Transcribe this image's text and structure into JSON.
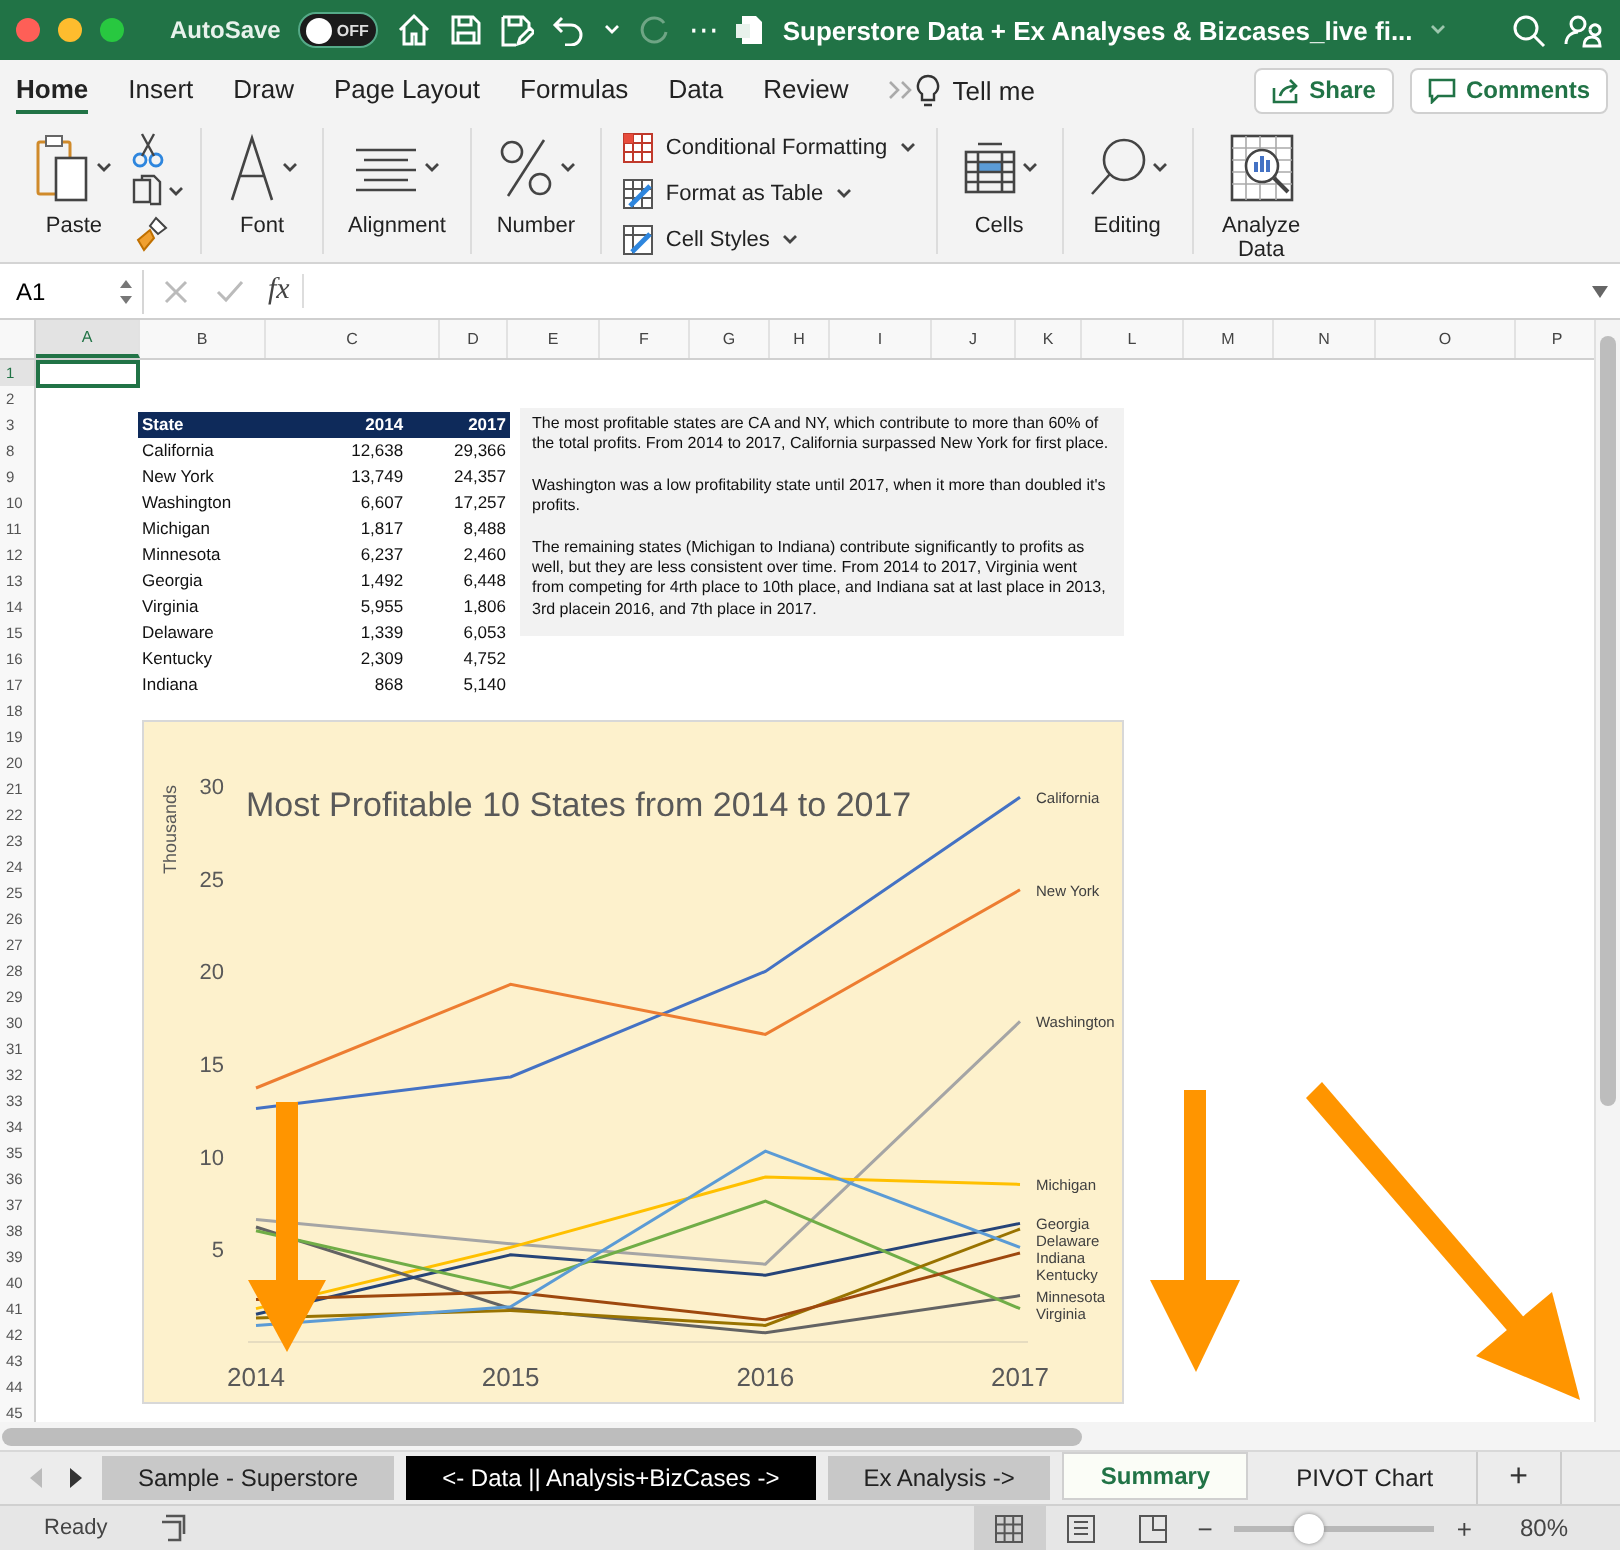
{
  "title_bar": {
    "autosave_label": "AutoSave",
    "autosave_toggle": {
      "on": false,
      "label": "OFF"
    },
    "more": "⋯",
    "title": "Superstore Data + Ex Analyses & Bizcases_live fi..."
  },
  "ribbon_tabs": [
    {
      "label": "Home",
      "selected": true
    },
    {
      "label": "Insert",
      "selected": false
    },
    {
      "label": "Draw",
      "selected": false
    },
    {
      "label": "Page Layout",
      "selected": false
    },
    {
      "label": "Formulas",
      "selected": false
    },
    {
      "label": "Data",
      "selected": false
    },
    {
      "label": "Review",
      "selected": false
    }
  ],
  "tell_me": "Tell me",
  "share_button": "Share",
  "comments_button": "Comments",
  "ribbon": {
    "groups": [
      {
        "kind": "paste",
        "label": "Paste"
      },
      {
        "kind": "font",
        "label": "Font"
      },
      {
        "kind": "alignment",
        "label": "Alignment"
      },
      {
        "kind": "number",
        "label": "Number"
      },
      {
        "kind": "styles",
        "items": [
          "Conditional Formatting",
          "Format as Table",
          "Cell Styles"
        ]
      },
      {
        "kind": "cells",
        "label": "Cells"
      },
      {
        "kind": "editing",
        "label": "Editing"
      },
      {
        "kind": "analyze",
        "label": "Analyze Data"
      }
    ]
  },
  "formula_bar": {
    "name_box": "A1",
    "function_label": "fx"
  },
  "columns": [
    {
      "label": "A",
      "selected": true
    },
    {
      "label": "B",
      "selected": false
    },
    {
      "label": "C",
      "selected": false
    },
    {
      "label": "D",
      "selected": false
    },
    {
      "label": "E",
      "selected": false
    },
    {
      "label": "F",
      "selected": false
    },
    {
      "label": "G",
      "selected": false
    },
    {
      "label": "H",
      "selected": false
    },
    {
      "label": "I",
      "selected": false
    },
    {
      "label": "J",
      "selected": false
    },
    {
      "label": "K",
      "selected": false
    },
    {
      "label": "L",
      "selected": false
    },
    {
      "label": "M",
      "selected": false
    },
    {
      "label": "N",
      "selected": false
    },
    {
      "label": "O",
      "selected": false
    },
    {
      "label": "P",
      "selected": false
    }
  ],
  "rows": [
    {
      "label": "1",
      "selected": true
    },
    {
      "label": "2",
      "selected": false
    },
    {
      "label": "3",
      "selected": false
    },
    {
      "label": "8",
      "selected": false
    },
    {
      "label": "9",
      "selected": false
    },
    {
      "label": "10",
      "selected": false
    },
    {
      "label": "11",
      "selected": false
    },
    {
      "label": "12",
      "selected": false
    },
    {
      "label": "13",
      "selected": false
    },
    {
      "label": "14",
      "selected": false
    },
    {
      "label": "15",
      "selected": false
    },
    {
      "label": "16",
      "selected": false
    },
    {
      "label": "17",
      "selected": false
    },
    {
      "label": "18",
      "selected": false
    },
    {
      "label": "19",
      "selected": false
    },
    {
      "label": "20",
      "selected": false
    },
    {
      "label": "21",
      "selected": false
    },
    {
      "label": "22",
      "selected": false
    },
    {
      "label": "23",
      "selected": false
    },
    {
      "label": "24",
      "selected": false
    },
    {
      "label": "25",
      "selected": false
    },
    {
      "label": "26",
      "selected": false
    },
    {
      "label": "27",
      "selected": false
    },
    {
      "label": "28",
      "selected": false
    },
    {
      "label": "29",
      "selected": false
    },
    {
      "label": "30",
      "selected": false
    },
    {
      "label": "31",
      "selected": false
    },
    {
      "label": "32",
      "selected": false
    },
    {
      "label": "33",
      "selected": false
    },
    {
      "label": "34",
      "selected": false
    },
    {
      "label": "35",
      "selected": false
    },
    {
      "label": "36",
      "selected": false
    },
    {
      "label": "37",
      "selected": false
    },
    {
      "label": "38",
      "selected": false
    },
    {
      "label": "39",
      "selected": false
    },
    {
      "label": "40",
      "selected": false
    },
    {
      "label": "41",
      "selected": false
    },
    {
      "label": "42",
      "selected": false
    },
    {
      "label": "43",
      "selected": false
    },
    {
      "label": "44",
      "selected": false
    },
    {
      "label": "45",
      "selected": false
    }
  ],
  "table": {
    "columns": [
      "State",
      "2014",
      "2017"
    ],
    "rows": [
      [
        "California",
        "12,638",
        "29,366"
      ],
      [
        "New York",
        "13,749",
        "24,357"
      ],
      [
        "Washington",
        "6,607",
        "17,257"
      ],
      [
        "Michigan",
        "1,817",
        "8,488"
      ],
      [
        "Minnesota",
        "6,237",
        "2,460"
      ],
      [
        "Georgia",
        "1,492",
        "6,448"
      ],
      [
        "Virginia",
        "5,955",
        "1,806"
      ],
      [
        "Delaware",
        "1,339",
        "6,053"
      ],
      [
        "Kentucky",
        "2,309",
        "4,752"
      ],
      [
        "Indiana",
        "868",
        "5,140"
      ]
    ]
  },
  "text_box": {
    "paragraphs": [
      "The most profitable states are CA and NY, which contribute to more than 60% of the total profits. From 2014 to 2017, California surpassed New York for first place.",
      "Washington was a low profitability state until 2017, when it more than doubled it's profits.",
      "The remaining states (Michigan to Indiana) contribute significantly to profits as well, but they are less consistent over time. From 2014 to 2017, Virginia went from competing for 4rth place to 10th place, and Indiana sat at last place in 2013, 3rd placein 2016, and 7th place in 2017."
    ]
  },
  "chart": {
    "chart_data": {
      "type": "line",
      "title": "Most Profitable 10 States from 2014 to 2017",
      "ylabel": "Thousands",
      "categories": [
        "2014",
        "2015",
        "2016",
        "2017"
      ],
      "ylim": [
        0,
        30
      ],
      "yticks": [
        5,
        10,
        15,
        20,
        25,
        30
      ],
      "series": [
        {
          "name": "California",
          "color": "#4472c4",
          "values": [
            12.6,
            14.3,
            20.0,
            29.4
          ]
        },
        {
          "name": "New York",
          "color": "#ed7d31",
          "values": [
            13.7,
            19.3,
            16.6,
            24.4
          ]
        },
        {
          "name": "Washington",
          "color": "#a5a5a5",
          "values": [
            6.6,
            5.3,
            4.2,
            17.3
          ]
        },
        {
          "name": "Michigan",
          "color": "#ffc000",
          "values": [
            1.8,
            5.1,
            8.9,
            8.5
          ]
        },
        {
          "name": "Minnesota",
          "color": "#636363",
          "values": [
            6.2,
            1.8,
            0.5,
            2.5
          ]
        },
        {
          "name": "Georgia",
          "color": "#264478",
          "values": [
            1.5,
            4.7,
            3.6,
            6.4
          ]
        },
        {
          "name": "Virginia",
          "color": "#70ad47",
          "values": [
            6.0,
            2.9,
            7.6,
            1.8
          ]
        },
        {
          "name": "Delaware",
          "color": "#997300",
          "values": [
            1.3,
            1.7,
            0.9,
            6.1
          ]
        },
        {
          "name": "Kentucky",
          "color": "#9e480e",
          "values": [
            2.3,
            2.7,
            1.2,
            4.8
          ]
        },
        {
          "name": "Indiana",
          "color": "#5b9bd5",
          "values": [
            0.9,
            1.9,
            10.3,
            5.1
          ]
        }
      ]
    }
  },
  "sheet_tabs": {
    "nav": [
      {
        "kind": "prev",
        "disabled": true
      },
      {
        "kind": "next",
        "disabled": false
      }
    ],
    "tabs": [
      {
        "label": "Sample - Superstore",
        "selected": false,
        "color": "#c8c8c8"
      },
      {
        "label": "<- Data || Analysis+BizCases ->",
        "selected": false,
        "color": "#000000"
      },
      {
        "label": "Ex Analysis ->",
        "selected": false,
        "color": "#c8c8c8"
      },
      {
        "label": "Summary",
        "selected": true
      },
      {
        "label": "PIVOT Chart",
        "selected": false
      }
    ],
    "add": "+"
  },
  "status_bar": {
    "status": "Ready",
    "views": [
      {
        "kind": "normal",
        "selected": true
      },
      {
        "kind": "page_layout",
        "selected": false
      },
      {
        "kind": "page_break",
        "selected": false
      }
    ],
    "zoom": {
      "minus": "−",
      "plus": "+",
      "level": 0.37,
      "reading": "80%"
    }
  }
}
